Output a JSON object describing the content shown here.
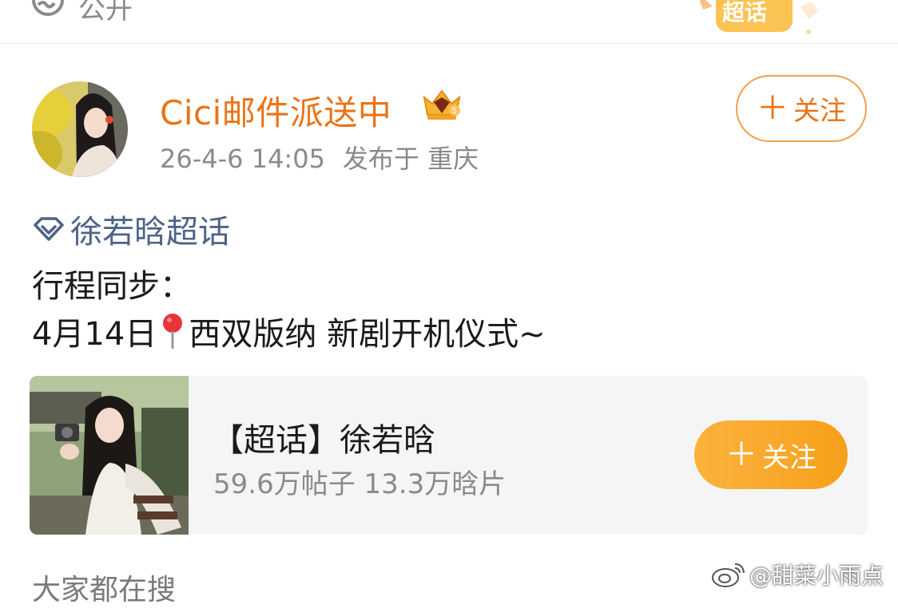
{
  "top": {
    "visibility_label": "公开",
    "sticker_label": "超话"
  },
  "post": {
    "username": "Cici邮件派送中",
    "timestamp": "26-4-6 14:05",
    "location": "发布于 重庆",
    "follow_label": "关注",
    "topic_label": "徐若晗超话",
    "text_line1": "行程同步：",
    "text_line2_date": "4月14日",
    "text_line2_rest": "西双版纳 新剧开机仪式~"
  },
  "card": {
    "title": "【超话】徐若晗",
    "stats": "59.6万帖子 13.3万晗片",
    "follow_label": "关注"
  },
  "section": {
    "heading": "大家都在搜"
  },
  "watermark": {
    "text": "@甜菜小雨点"
  },
  "colors": {
    "username": "#eb7316",
    "topic": "#4d6487",
    "follow_border": "#f0a04e",
    "card_follow_bg": "#f6a01b"
  },
  "icons": [
    "globe-icon",
    "chaohua-sticker",
    "vip-crown-badge",
    "plus-icon",
    "diamond-topic-icon",
    "location-pin-icon",
    "weibo-logo-icon"
  ]
}
